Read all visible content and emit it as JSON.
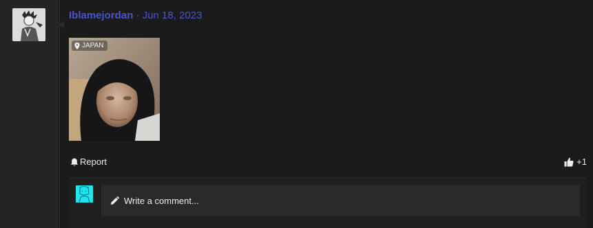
{
  "post": {
    "username": "Iblamejordan",
    "separator": "·",
    "date": "Jun 18, 2023",
    "media": {
      "location_label": "JAPAN",
      "location_icon": "map-pin-icon"
    },
    "actions": {
      "report_label": "Report",
      "report_icon": "bell-icon",
      "like_count": "+1",
      "like_icon": "thumbs-up-icon"
    },
    "comment": {
      "placeholder": "Write a comment...",
      "icon": "pencil-icon"
    }
  },
  "colors": {
    "accent": "#4a55c9",
    "background": "#1b1b1b",
    "sidebar": "#242424",
    "comment_box": "#2a2a2a",
    "commenter_avatar": "#1de6f0"
  }
}
